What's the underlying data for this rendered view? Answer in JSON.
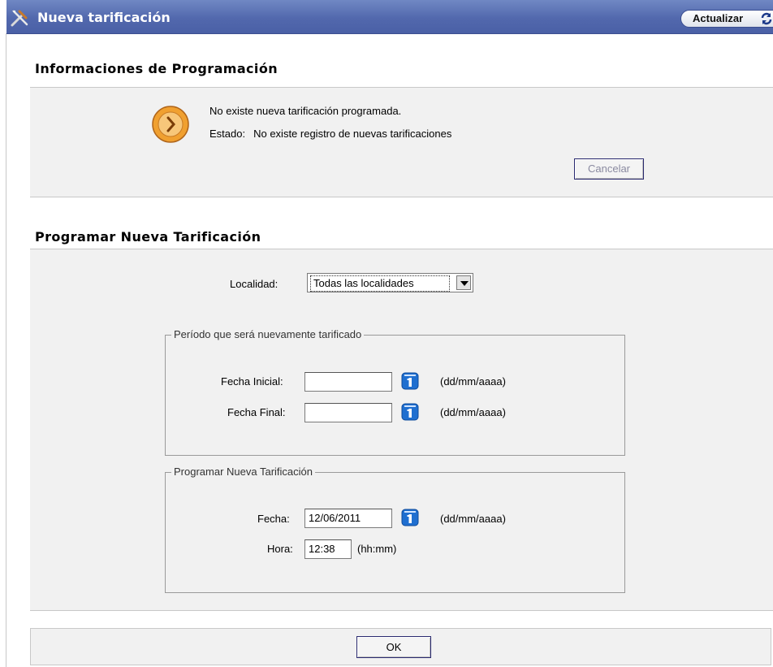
{
  "header": {
    "title": "Nueva tarificación",
    "refresh_label": "Actualizar"
  },
  "schedule_info": {
    "title": "Informaciones de Programación",
    "message": "No existe nueva tarificación programada.",
    "status_label": "Estado:",
    "status_value": "No existe registro de nuevas tarificaciones",
    "cancel_label": "Cancelar"
  },
  "new_schedule": {
    "title": "Programar Nueva Tarificación",
    "locality_label": "Localidad:",
    "locality_value": "Todas las localidades",
    "period": {
      "legend": "Período que será nuevamente tarificado",
      "start_label": "Fecha Inicial:",
      "start_value": "",
      "end_label": "Fecha Final:",
      "end_value": "",
      "date_format": "(dd/mm/aaaa)"
    },
    "schedule": {
      "legend": "Programar Nueva Tarificación",
      "date_label": "Fecha:",
      "date_value": "12/06/2011",
      "date_format": "(dd/mm/aaaa)",
      "time_label": "Hora:",
      "time_value": "12:38",
      "time_format": "(hh:mm)"
    }
  },
  "ok_label": "OK",
  "colors": {
    "header": "#5268ad",
    "panel": "#f1f1f1",
    "calendar_icon": "#1f6fd0"
  },
  "icons": [
    "tools-icon",
    "refresh-icon",
    "clock-icon",
    "calendar-icon"
  ]
}
